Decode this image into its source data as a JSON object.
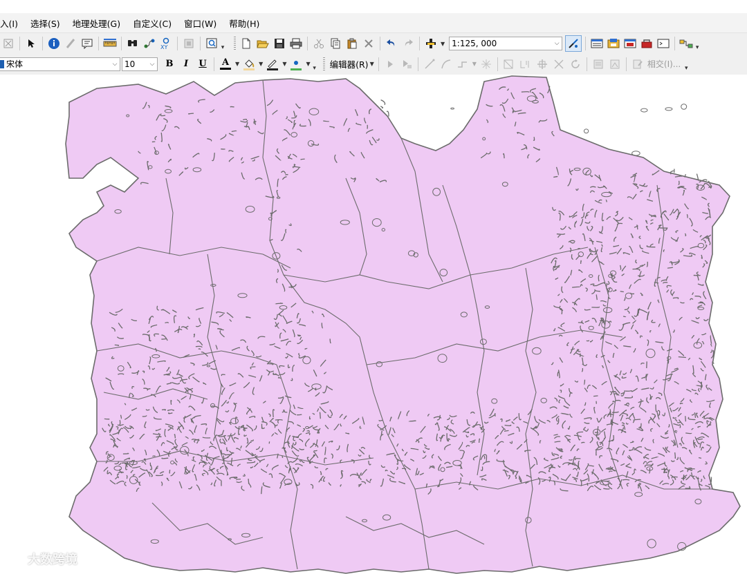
{
  "menu": [
    {
      "key": "insert",
      "label": "入(I)"
    },
    {
      "key": "selection",
      "label": "选择(S)"
    },
    {
      "key": "geoprocessing",
      "label": "地理处理(G)"
    },
    {
      "key": "customize",
      "label": "自定义(C)"
    },
    {
      "key": "window",
      "label": "窗口(W)"
    },
    {
      "key": "help",
      "label": "帮助(H)"
    }
  ],
  "standard_toolbar": {
    "scale_value": "1:125, 000"
  },
  "draw_toolbar": {
    "font_name": "宋体",
    "font_size": "10",
    "bold_label": "B",
    "italic_label": "I",
    "underline_label": "U",
    "font_color_label": "A"
  },
  "editor_toolbar": {
    "editor_label": "编辑器(R)",
    "intersect_label": "相交(I)..."
  },
  "map": {
    "fill_color": "#efcaf4",
    "outline_color": "#6b6b6b"
  },
  "watermark": {
    "text": "大数跨境"
  }
}
